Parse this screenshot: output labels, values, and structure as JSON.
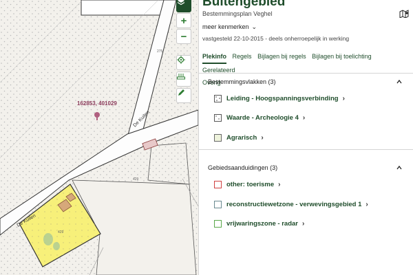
{
  "map": {
    "coordinates": "162853, 401029",
    "street_labels": [
      "De Kuilen",
      "De Kuilen"
    ],
    "parcel_numbers": [
      "275",
      "429",
      "429",
      "429"
    ],
    "tools": [
      "layers-icon",
      "zoom-in-icon",
      "zoom-out-icon",
      "locate-icon",
      "measure-icon",
      "draw-icon"
    ]
  },
  "panel": {
    "title": "Buitengebied",
    "subtitle": "Bestemmingsplan  Veghel",
    "meer": "meer kenmerken",
    "status": "vastgesteld 22-10-2015 - deels onherroepelijk in werking",
    "tabs": [
      "Plekinfo",
      "Regels",
      "Bijlagen bij regels",
      "Bijlagen bij toelichting",
      "Gerelateerd",
      "Overig"
    ],
    "sections": [
      {
        "title": "Bestemmingsvlakken (3)",
        "items": [
          {
            "label": "Leiding - Hoogspanningsverbinding",
            "swatch": "#ffffff",
            "border": "#444444"
          },
          {
            "label": "Waarde - Archeologie 4",
            "swatch": "#ffffff",
            "border": "#444444"
          },
          {
            "label": "Agrarisch",
            "swatch": "#eef3dc",
            "border": "#666666"
          }
        ]
      },
      {
        "title": "Gebiedsaanduidingen (3)",
        "items": [
          {
            "label": "other: toerisme",
            "swatch": "#ffffff",
            "border": "#d04040"
          },
          {
            "label": "reconstructiewetzone - verwevingsgebied 1",
            "swatch": "#ffffff",
            "border": "#6a8a90"
          },
          {
            "label": "vrijwaringszone - radar",
            "swatch": "#ffffff",
            "border": "#5aa84a"
          }
        ]
      }
    ]
  },
  "colors": {
    "brand": "#1f4d2b",
    "accent": "#2e7d32",
    "map_bg": "#f4f2ee",
    "parcel_yellow": "#f7f07a"
  }
}
